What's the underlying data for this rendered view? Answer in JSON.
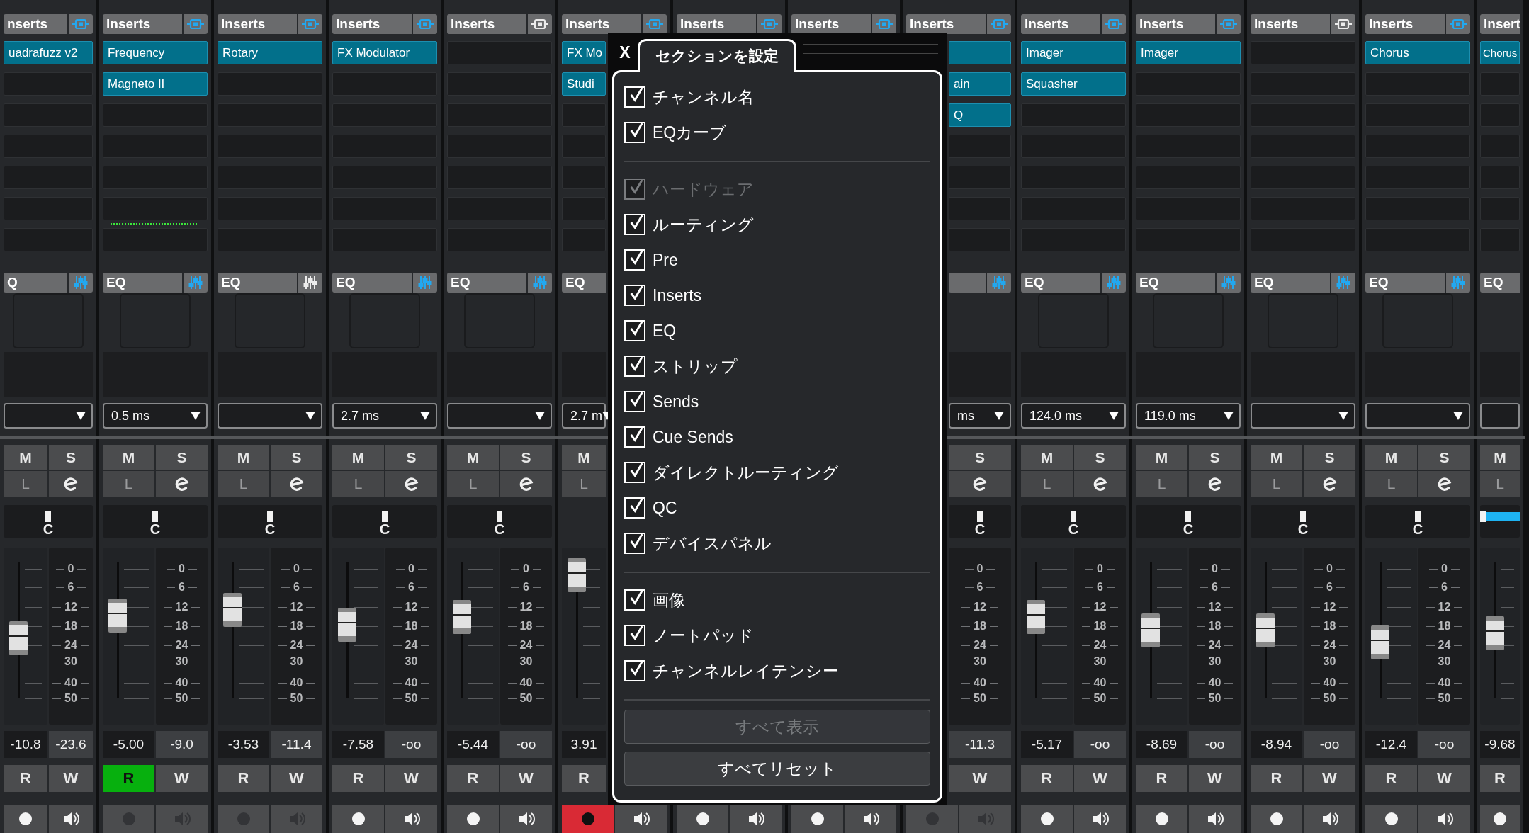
{
  "strips": [
    {
      "kind": "clip-left",
      "header": {
        "title": "nserts",
        "enabled": true
      },
      "inserts": [
        {
          "filled": true,
          "name": "uadrafuzz v2"
        }
      ],
      "eq": {
        "title": "Q",
        "enabled": true
      },
      "mute": "M",
      "solo": "S",
      "link": "L",
      "pan": {
        "label": "C",
        "level": 0.5
      },
      "fader": {
        "level": 0.43
      },
      "meter_scale": [
        "0",
        "6",
        "12",
        "18",
        "24",
        "30",
        "40",
        "50"
      ],
      "volume": "-10.8",
      "peak": "-23.6",
      "read": {
        "label": "R",
        "on": false
      },
      "write": "W",
      "input_enabled": true,
      "record_armed": false
    },
    {
      "kind": "full",
      "header": {
        "title": "Inserts",
        "enabled": true
      },
      "inserts": [
        {
          "filled": true,
          "name": "Frequency"
        },
        {
          "filled": true,
          "name": "Magneto II"
        }
      ],
      "slot_meter": true,
      "eq": {
        "title": "EQ",
        "enabled": true
      },
      "delay": "0.5 ms",
      "mute": "M",
      "solo": "S",
      "link": "L",
      "pan": {
        "label": "C",
        "level": 0.5
      },
      "fader": {
        "level": 0.6
      },
      "meter_scale": [
        "0",
        "6",
        "12",
        "18",
        "24",
        "30",
        "40",
        "50"
      ],
      "volume": "-5.00",
      "peak": "-9.0",
      "read": {
        "label": "R",
        "on": true
      },
      "write": "W",
      "input_enabled": false,
      "record_armed": false
    },
    {
      "kind": "full",
      "header": {
        "title": "Inserts",
        "enabled": true
      },
      "inserts": [
        {
          "filled": true,
          "name": "Rotary"
        }
      ],
      "eq": {
        "title": "EQ",
        "enabled": false
      },
      "mute": "M",
      "solo": "S",
      "link": "L",
      "pan": {
        "label": "C",
        "level": 0.5
      },
      "fader": {
        "level": 0.64
      },
      "meter_scale": [
        "0",
        "6",
        "12",
        "18",
        "24",
        "30",
        "40",
        "50"
      ],
      "volume": "-3.53",
      "peak": "-11.4",
      "read": {
        "label": "R",
        "on": false
      },
      "write": "W",
      "input_enabled": false,
      "record_armed": false
    },
    {
      "kind": "full",
      "header": {
        "title": "Inserts",
        "enabled": true
      },
      "inserts": [
        {
          "filled": true,
          "name": "FX Modulator"
        }
      ],
      "eq": {
        "title": "EQ",
        "enabled": true
      },
      "delay": "2.7 ms",
      "mute": "M",
      "solo": "S",
      "link": "L",
      "pan": {
        "label": "C",
        "level": 0.5
      },
      "fader": {
        "level": 0.53
      },
      "meter_scale": [
        "0",
        "6",
        "12",
        "18",
        "24",
        "30",
        "40",
        "50"
      ],
      "volume": "-7.58",
      "peak": "-oo",
      "read": {
        "label": "R",
        "on": false
      },
      "write": "W",
      "input_enabled": true,
      "record_armed": false
    },
    {
      "kind": "full",
      "header": {
        "title": "Inserts",
        "enabled": false
      },
      "eq": {
        "title": "EQ",
        "enabled": true
      },
      "mute": "M",
      "solo": "S",
      "link": "L",
      "pan": {
        "label": "C",
        "level": 0.5
      },
      "fader": {
        "level": 0.59
      },
      "meter_scale": [
        "0",
        "6",
        "12",
        "18",
        "24",
        "30",
        "40",
        "50"
      ],
      "volume": "-5.44",
      "peak": "-oo",
      "read": {
        "label": "R",
        "on": false
      },
      "write": "W",
      "input_enabled": true,
      "record_armed": false
    },
    {
      "kind": "cover-right",
      "header": {
        "title": "Inserts",
        "enabled": true
      },
      "inserts": [
        {
          "filled": true,
          "name": "FX Mo"
        },
        {
          "filled": true,
          "name": "Studi"
        }
      ],
      "eq": {
        "title": "EQ"
      },
      "delay": "2.7 m",
      "mute": "M",
      "link": "L",
      "fader": {
        "level": 0.9
      },
      "volume": "3.91",
      "read": {
        "label": "R",
        "on": false
      },
      "input_enabled": true,
      "record_armed": true
    },
    {
      "kind": "covered",
      "header": {
        "title": "Inserts",
        "enabled": true
      },
      "input_enabled": true,
      "record_armed": false
    },
    {
      "kind": "covered",
      "header": {
        "title": "Inserts",
        "enabled": true
      },
      "input_enabled": true,
      "record_armed": false
    },
    {
      "kind": "cover-left",
      "header": {
        "title": "Inserts",
        "enabled": true
      },
      "inserts": [
        {
          "filled": true
        },
        {
          "filled": true,
          "name": "ain"
        },
        {
          "filled": true,
          "name": "Q"
        }
      ],
      "eq": {
        "enabled": true
      },
      "delay": "ms",
      "solo": "S",
      "pan": {
        "label": "C",
        "level": 0.5
      },
      "meter_scale": [
        "0",
        "6",
        "12",
        "18",
        "24",
        "30",
        "40",
        "50"
      ],
      "peak": "-11.3",
      "write": "W",
      "input_enabled": false,
      "record_armed": false
    },
    {
      "kind": "full",
      "header": {
        "title": "Inserts",
        "enabled": true
      },
      "inserts": [
        {
          "filled": true,
          "name": "Imager"
        },
        {
          "filled": true,
          "name": "Squasher"
        }
      ],
      "eq": {
        "title": "EQ",
        "enabled": true
      },
      "delay": "124.0 ms",
      "mute": "M",
      "solo": "S",
      "link": "L",
      "pan": {
        "label": "C",
        "level": 0.5
      },
      "fader": {
        "level": 0.59
      },
      "meter_scale": [
        "0",
        "6",
        "12",
        "18",
        "24",
        "30",
        "40",
        "50"
      ],
      "volume": "-5.17",
      "peak": "-oo",
      "read": {
        "label": "R",
        "on": false
      },
      "write": "W",
      "input_enabled": true,
      "record_armed": false
    },
    {
      "kind": "full",
      "header": {
        "title": "Inserts",
        "enabled": true
      },
      "inserts": [
        {
          "filled": true,
          "name": "Imager"
        }
      ],
      "eq": {
        "title": "EQ",
        "enabled": true
      },
      "delay": "119.0 ms",
      "mute": "M",
      "solo": "S",
      "link": "L",
      "pan": {
        "label": "C",
        "level": 0.5
      },
      "fader": {
        "level": 0.49
      },
      "meter_scale": [
        "0",
        "6",
        "12",
        "18",
        "24",
        "30",
        "40",
        "50"
      ],
      "volume": "-8.69",
      "peak": "-oo",
      "read": {
        "label": "R",
        "on": false
      },
      "write": "W",
      "input_enabled": true,
      "record_armed": false
    },
    {
      "kind": "full",
      "header": {
        "title": "Inserts",
        "enabled": false
      },
      "eq": {
        "title": "EQ",
        "enabled": true
      },
      "mute": "M",
      "solo": "S",
      "link": "L",
      "pan": {
        "label": "C",
        "level": 0.5
      },
      "fader": {
        "level": 0.49
      },
      "meter_scale": [
        "0",
        "6",
        "12",
        "18",
        "24",
        "30",
        "40",
        "50"
      ],
      "volume": "-8.94",
      "peak": "-oo",
      "read": {
        "label": "R",
        "on": false
      },
      "write": "W",
      "input_enabled": true,
      "record_armed": false
    },
    {
      "kind": "full",
      "header": {
        "title": "Inserts",
        "enabled": true
      },
      "inserts": [
        {
          "filled": true,
          "name": "Chorus"
        }
      ],
      "eq": {
        "title": "EQ",
        "enabled": true
      },
      "mute": "M",
      "solo": "S",
      "link": "L",
      "pan": {
        "label": "C",
        "level": 0.5
      },
      "fader": {
        "level": 0.4
      },
      "meter_scale": [
        "0",
        "6",
        "12",
        "18",
        "24",
        "30",
        "40",
        "50"
      ],
      "volume": "-12.4",
      "peak": "-oo",
      "read": {
        "label": "R",
        "on": false
      },
      "write": "W",
      "input_enabled": true,
      "record_armed": false
    },
    {
      "kind": "clip-right",
      "header": {
        "title": "Insert"
      },
      "inserts": [
        {
          "filled": true,
          "name": "Chorus"
        }
      ],
      "eq": {
        "title": "EQ"
      },
      "mute": "M",
      "link": "L",
      "pan": {
        "level": 0
      },
      "fader": {
        "level": 0.47
      },
      "volume": "-9.68",
      "read": {
        "label": "R",
        "on": false
      },
      "input_enabled": true,
      "record_armed": false
    }
  ],
  "dialog": {
    "close": "X",
    "title": "セクションを設定",
    "groups": [
      {
        "items": [
          {
            "label": "チャンネル名",
            "checked": true,
            "disabled": false
          },
          {
            "label": "EQカーブ",
            "checked": true,
            "disabled": false
          }
        ]
      },
      {
        "items": [
          {
            "label": "ハードウェア",
            "checked": true,
            "disabled": true
          },
          {
            "label": "ルーティング",
            "checked": true,
            "disabled": false
          },
          {
            "label": "Pre",
            "checked": true,
            "disabled": false
          },
          {
            "label": "Inserts",
            "checked": true,
            "disabled": false
          },
          {
            "label": "EQ",
            "checked": true,
            "disabled": false
          },
          {
            "label": "ストリップ",
            "checked": true,
            "disabled": false
          },
          {
            "label": "Sends",
            "checked": true,
            "disabled": false
          },
          {
            "label": "Cue Sends",
            "checked": true,
            "disabled": false
          },
          {
            "label": "ダイレクトルーティング",
            "checked": true,
            "disabled": false
          },
          {
            "label": "QC",
            "checked": true,
            "disabled": false
          },
          {
            "label": "デバイスパネル",
            "checked": true,
            "disabled": false
          }
        ]
      },
      {
        "items": [
          {
            "label": "画像",
            "checked": true,
            "disabled": false
          },
          {
            "label": "ノートパッド",
            "checked": true,
            "disabled": false
          },
          {
            "label": "チャンネルレイテンシー",
            "checked": true,
            "disabled": false
          }
        ]
      }
    ],
    "buttons": [
      {
        "label": "すべて表示",
        "disabled": true
      },
      {
        "label": "すべてリセット",
        "disabled": false
      }
    ]
  }
}
